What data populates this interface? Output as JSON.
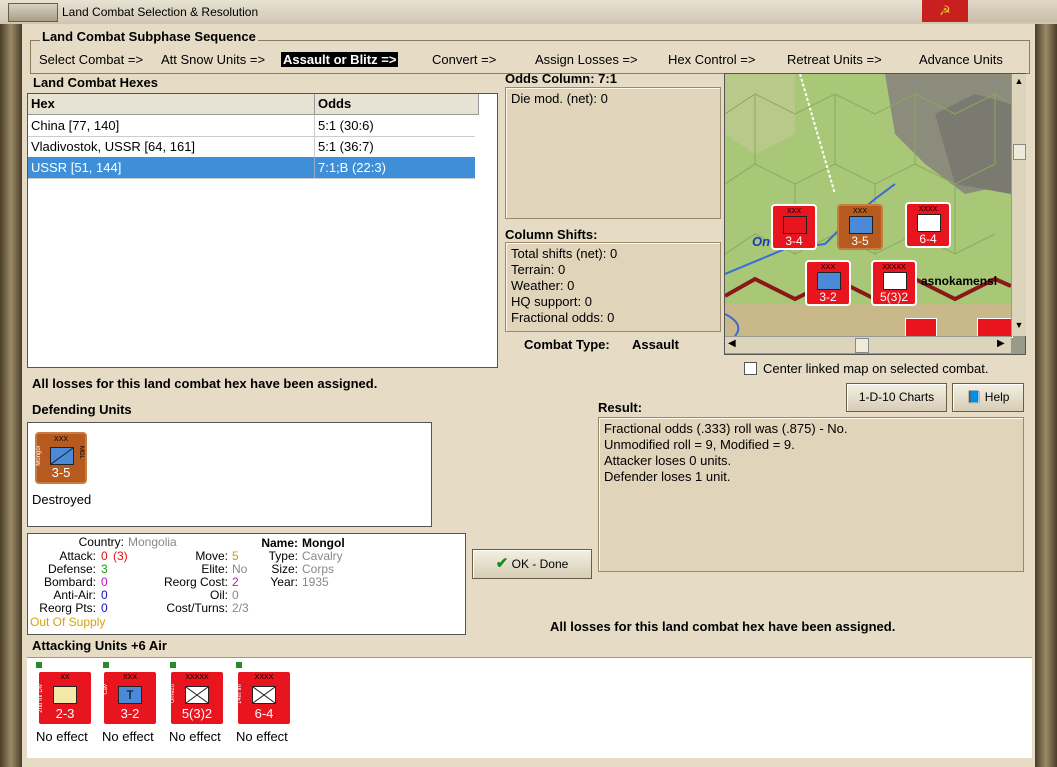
{
  "window": {
    "title": "Land Combat Selection & Resolution",
    "close_icon": "☭"
  },
  "subphase": {
    "label": "Land Combat Subphase Sequence",
    "steps": [
      "Select Combat =>",
      "Att Snow Units =>",
      "Assault or Blitz =>",
      "Convert =>",
      "Assign Losses =>",
      "Hex Control =>",
      "Retreat Units =>",
      "Advance Units"
    ],
    "active_index": 2
  },
  "hexes": {
    "label": "Land Combat Hexes",
    "columns": [
      "Hex",
      "Odds"
    ],
    "rows": [
      [
        "China [77, 140]",
        "5:1 (30:6)"
      ],
      [
        "Vladivostok, USSR [64, 161]",
        "5:1 (36:7)"
      ],
      [
        "USSR [51, 144]",
        "7:1;B (22:3)"
      ]
    ],
    "selected_index": 2
  },
  "odds": {
    "label": "Odds Column: 7:1",
    "die_mod": "Die mod. (net): 0"
  },
  "shifts": {
    "label": "Column Shifts:",
    "items": [
      "Total shifts (net): 0",
      "Terrain: 0",
      "Weather: 0",
      "HQ support: 0",
      "Fractional odds: 0"
    ]
  },
  "combat_type": {
    "label": "Combat Type:",
    "value": "Assault"
  },
  "map": {
    "labels": {
      "town": "asnokamensl",
      "river": "On"
    },
    "counters": [
      {
        "label": "3-4",
        "size": "XXX",
        "side": "Zabayk Mil"
      },
      {
        "label": "3-5",
        "size": "XXX",
        "side": "Mongol"
      },
      {
        "label": "6-4",
        "size": "XXXX",
        "side": "14th Inf"
      },
      {
        "label": "3-2",
        "size": "XXX",
        "side": "Cav"
      },
      {
        "label": "5(3)2",
        "size": "XXXXX",
        "side": "Umezu"
      }
    ]
  },
  "center_map": {
    "label": "Center linked map on selected combat.",
    "checked": false
  },
  "losses_msg": "All losses for this land combat hex have been assigned.",
  "buttons": {
    "charts": "1-D-10 Charts",
    "help": "Help",
    "ok": "OK - Done"
  },
  "defending": {
    "label": "Defending Units",
    "units": [
      {
        "label": "3-5",
        "size": "XXX",
        "side": "Mongol",
        "side_r": "MGL",
        "status": "Destroyed"
      }
    ]
  },
  "unit_info": {
    "country_label": "Country:",
    "country": "Mongolia",
    "attack_label": "Attack:",
    "attack": "0",
    "attack_orig": "(3)",
    "defense_label": "Defense:",
    "defense": "3",
    "bombard_label": "Bombard:",
    "bombard": "0",
    "antiair_label": "Anti-Air:",
    "antiair": "0",
    "reorgpts_label": "Reorg Pts:",
    "reorgpts": "0",
    "supply": "Out Of Supply",
    "move_label": "Move:",
    "move": "5",
    "elite_label": "Elite:",
    "elite": "No",
    "reorgcost_label": "Reorg Cost:",
    "reorgcost": "2",
    "oil_label": "Oil:",
    "oil": "0",
    "costturns_label": "Cost/Turns:",
    "costturns": "2/3",
    "name_label": "Name:",
    "name": "Mongol",
    "type_label": "Type:",
    "type": "Cavalry",
    "size_label": "Size:",
    "size": "Corps",
    "year_label": "Year:",
    "year": "1935"
  },
  "result": {
    "label": "Result:",
    "lines": [
      "Fractional odds (.333) roll was (.875)  - No.",
      "Unmodified roll = 9, Modified = 9.",
      "Attacker loses 0 units.",
      "Defender loses 1 unit."
    ]
  },
  "attacking": {
    "label": "Attacking Units +6 Air",
    "units": [
      {
        "label": "2-3",
        "size": "XX",
        "side": "2nd Inf Div",
        "status": "No effect"
      },
      {
        "label": "3-2",
        "size": "XXX",
        "side": "Cav",
        "status": "No effect"
      },
      {
        "label": "5(3)2",
        "size": "XXXXX",
        "side": "Umezu",
        "status": "No effect"
      },
      {
        "label": "6-4",
        "size": "XXXX",
        "side": "14th Inf",
        "status": "No effect"
      }
    ]
  },
  "colors": {
    "unit_red": "#e8141e",
    "mongol_brown": "#b65a20",
    "selection_blue": "#3f8fd8"
  }
}
